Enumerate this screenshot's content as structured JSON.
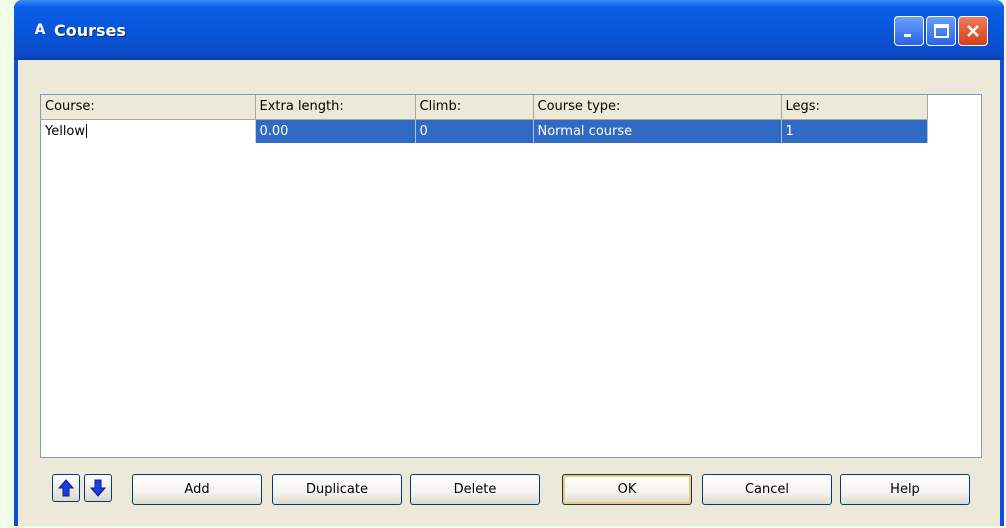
{
  "window": {
    "title": "Courses",
    "app_icon": "A"
  },
  "titlebar_buttons": [
    "minimize-icon",
    "maximize-icon",
    "close-icon"
  ],
  "grid": {
    "columns": [
      "Course:",
      "Extra length:",
      "Climb:",
      "Course type:",
      "Legs:"
    ],
    "rows": [
      [
        "Yellow",
        "0.00",
        "0",
        "Normal course",
        "1"
      ]
    ]
  },
  "buttons": {
    "move_up": "arrow-up-icon",
    "move_down": "arrow-down-icon",
    "add": "Add",
    "duplicate": "Duplicate",
    "delete": "Delete",
    "ok": "OK",
    "cancel": "Cancel",
    "help": "Help"
  },
  "colors": {
    "title_bar": "#0854d8",
    "selection": "#316ac5",
    "dialog_bg": "#ece9d8"
  }
}
